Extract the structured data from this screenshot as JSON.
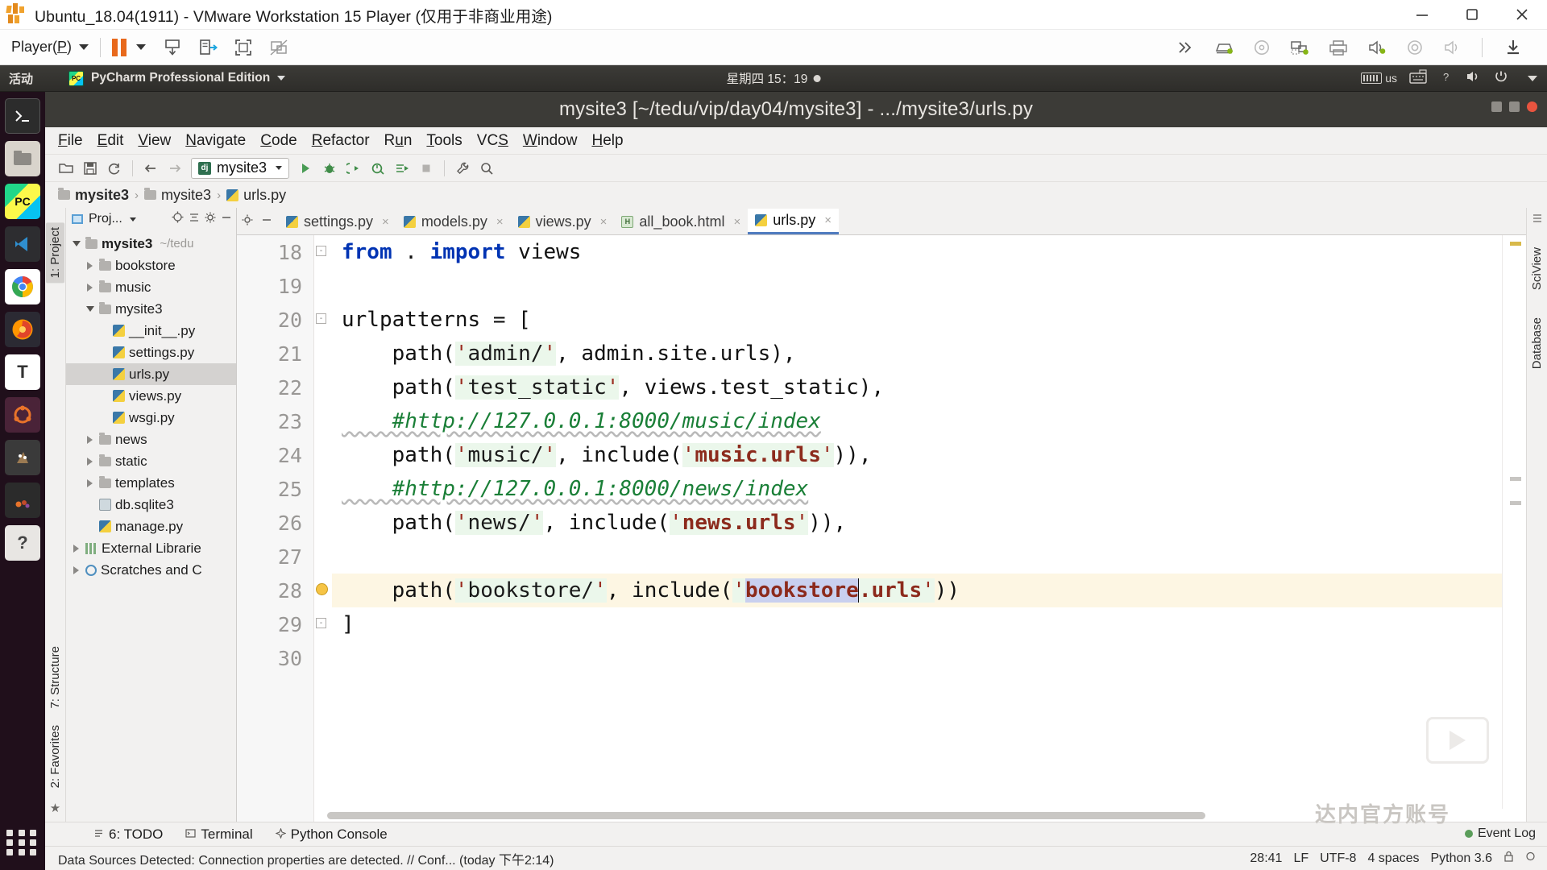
{
  "vmware": {
    "title": "Ubuntu_18.04(1911) - VMware Workstation 15 Player (仅用于非商业用途)",
    "logo_name": "vmware-logo",
    "player_menu": "Player(P)",
    "window_buttons": [
      "minimize",
      "restore",
      "close"
    ],
    "toolbar_icons": [
      "pause-icon",
      "suspend-icon",
      "send-ctrl-alt-del-icon",
      "fullscreen-icon",
      "unity-mode-icon"
    ],
    "right_icons": [
      "expand-icon",
      "removable-hdd-icon",
      "cd-dvd-icon",
      "network-adapter-icon",
      "printer-icon",
      "sound-card-icon",
      "camera-icon",
      "speaker-icon",
      "download-icon"
    ]
  },
  "ubuntu": {
    "activities": "活动",
    "app_name": "PyCharm Professional Edition",
    "clock": "星期四 15：19",
    "tray": [
      "keyboard-layout-us",
      "onscreen-keyboard-icon",
      "help-icon",
      "volume-icon",
      "power-icon"
    ],
    "keyboard_layout": "us",
    "launcher": [
      {
        "name": "terminal",
        "glyph": ">_"
      },
      {
        "name": "files",
        "glyph": ""
      },
      {
        "name": "pycharm",
        "glyph": "PC"
      },
      {
        "name": "vscode",
        "glyph": ""
      },
      {
        "name": "chrome",
        "glyph": ""
      },
      {
        "name": "firefox",
        "glyph": ""
      },
      {
        "name": "text-editor",
        "glyph": "T"
      },
      {
        "name": "ubuntu-software",
        "glyph": ""
      },
      {
        "name": "gimp",
        "glyph": ""
      },
      {
        "name": "software-updater",
        "glyph": ""
      },
      {
        "name": "help",
        "glyph": "?"
      }
    ]
  },
  "pycharm": {
    "window_title": "mysite3 [~/tedu/vip/day04/mysite3] - .../mysite3/urls.py",
    "menu": [
      {
        "label": "File",
        "mnemonic": "F"
      },
      {
        "label": "Edit",
        "mnemonic": "E"
      },
      {
        "label": "View",
        "mnemonic": "V"
      },
      {
        "label": "Navigate",
        "mnemonic": "N"
      },
      {
        "label": "Code",
        "mnemonic": "C"
      },
      {
        "label": "Refactor",
        "mnemonic": "R"
      },
      {
        "label": "Run",
        "mnemonic": "u"
      },
      {
        "label": "Tools",
        "mnemonic": "T"
      },
      {
        "label": "VCS",
        "mnemonic": "S"
      },
      {
        "label": "Window",
        "mnemonic": "W"
      },
      {
        "label": "Help",
        "mnemonic": "H"
      }
    ],
    "toolbar": {
      "icons": [
        "open-icon",
        "save-icon",
        "sync-icon",
        "back-icon",
        "forward-icon"
      ],
      "run_config": "mysite3",
      "run_icons": [
        "run-icon",
        "debug-icon",
        "run-coverage-icon",
        "profile-icon",
        "run-with-console-icon",
        "stop-icon"
      ],
      "end_icons": [
        "settings-wrench-icon",
        "search-icon"
      ]
    },
    "breadcrumb": [
      {
        "label": "mysite3",
        "icon": "folder-icon"
      },
      {
        "label": "mysite3",
        "icon": "folder-icon"
      },
      {
        "label": "urls.py",
        "icon": "python-file-icon"
      }
    ],
    "project_panel": {
      "title": "Proj...",
      "tools": [
        "target-icon",
        "collapse-all-icon",
        "settings-gear-icon",
        "hide-icon"
      ],
      "tree": [
        {
          "label": "mysite3",
          "hint": "~/tedu",
          "icon": "folder-icon",
          "twisty": "down",
          "depth": 0,
          "bold": true
        },
        {
          "label": "bookstore",
          "icon": "folder-icon",
          "twisty": "right",
          "depth": 1
        },
        {
          "label": "music",
          "icon": "folder-icon",
          "twisty": "right",
          "depth": 1
        },
        {
          "label": "mysite3",
          "icon": "folder-icon",
          "twisty": "down",
          "depth": 1
        },
        {
          "label": "__init__.py",
          "icon": "python-file-icon",
          "twisty": "none",
          "depth": 2
        },
        {
          "label": "settings.py",
          "icon": "python-file-icon",
          "twisty": "none",
          "depth": 2
        },
        {
          "label": "urls.py",
          "icon": "python-file-icon",
          "twisty": "none",
          "depth": 2,
          "selected": true
        },
        {
          "label": "views.py",
          "icon": "python-file-icon",
          "twisty": "none",
          "depth": 2
        },
        {
          "label": "wsgi.py",
          "icon": "python-file-icon",
          "twisty": "none",
          "depth": 2
        },
        {
          "label": "news",
          "icon": "folder-icon",
          "twisty": "right",
          "depth": 1
        },
        {
          "label": "static",
          "icon": "folder-icon",
          "twisty": "right",
          "depth": 1
        },
        {
          "label": "templates",
          "icon": "folder-icon",
          "twisty": "right",
          "depth": 1
        },
        {
          "label": "db.sqlite3",
          "icon": "sqlite-file-icon",
          "twisty": "none",
          "depth": 1
        },
        {
          "label": "manage.py",
          "icon": "python-file-icon",
          "twisty": "none",
          "depth": 1
        },
        {
          "label": "External Librarie",
          "icon": "library-icon",
          "twisty": "right",
          "depth": 0
        },
        {
          "label": "Scratches and C",
          "icon": "scratches-icon",
          "twisty": "right",
          "depth": 0
        }
      ]
    },
    "left_rail": [
      "1: Project",
      "7: Structure",
      "2: Favorites"
    ],
    "right_rail": [
      "SciView",
      "Database"
    ],
    "tabs": [
      {
        "label": "settings.py",
        "icon": "python-file-icon",
        "active": false
      },
      {
        "label": "models.py",
        "icon": "python-file-icon",
        "active": false
      },
      {
        "label": "views.py",
        "icon": "python-file-icon",
        "active": false
      },
      {
        "label": "all_book.html",
        "icon": "html-file-icon",
        "active": false
      },
      {
        "label": "urls.py",
        "icon": "python-file-icon",
        "active": true
      }
    ],
    "editor": {
      "first_line": 18,
      "lines": [
        {
          "n": 18,
          "fold": "collapse",
          "tokens": [
            {
              "t": "kw",
              "v": "from"
            },
            {
              "t": "p",
              "v": " . "
            },
            {
              "t": "kw",
              "v": "import"
            },
            {
              "t": "p",
              "v": " views"
            }
          ]
        },
        {
          "n": 19,
          "tokens": []
        },
        {
          "n": 20,
          "fold": "collapse",
          "tokens": [
            {
              "t": "p",
              "v": "urlpatterns = ["
            }
          ]
        },
        {
          "n": 21,
          "tokens": [
            {
              "t": "p",
              "v": "    path("
            },
            {
              "t": "q",
              "v": "'"
            },
            {
              "t": "str",
              "v": "admin/"
            },
            {
              "t": "q",
              "v": "'"
            },
            {
              "t": "p",
              "v": ", admin.site.urls),"
            }
          ]
        },
        {
          "n": 22,
          "tokens": [
            {
              "t": "p",
              "v": "    path("
            },
            {
              "t": "q",
              "v": "'"
            },
            {
              "t": "str",
              "v": "test_static"
            },
            {
              "t": "q",
              "v": "'"
            },
            {
              "t": "p",
              "v": ", views.test_static),"
            }
          ]
        },
        {
          "n": 23,
          "tokens": [
            {
              "t": "cmt",
              "v": "    #http://127.0.0.1:8000/music/index"
            }
          ]
        },
        {
          "n": 24,
          "tokens": [
            {
              "t": "p",
              "v": "    path("
            },
            {
              "t": "q",
              "v": "'"
            },
            {
              "t": "str",
              "v": "music/"
            },
            {
              "t": "q",
              "v": "'"
            },
            {
              "t": "p",
              "v": ", include("
            },
            {
              "t": "q",
              "v": "'"
            },
            {
              "t": "strred",
              "v": "music.urls"
            },
            {
              "t": "q",
              "v": "'"
            },
            {
              "t": "p",
              "v": ")),"
            }
          ]
        },
        {
          "n": 25,
          "tokens": [
            {
              "t": "cmt",
              "v": "    #http://127.0.0.1:8000/news/index"
            }
          ]
        },
        {
          "n": 26,
          "tokens": [
            {
              "t": "p",
              "v": "    path("
            },
            {
              "t": "q",
              "v": "'"
            },
            {
              "t": "str",
              "v": "news/"
            },
            {
              "t": "q",
              "v": "'"
            },
            {
              "t": "p",
              "v": ", include("
            },
            {
              "t": "q",
              "v": "'"
            },
            {
              "t": "strred",
              "v": "news.urls"
            },
            {
              "t": "q",
              "v": "'"
            },
            {
              "t": "p",
              "v": ")),"
            }
          ]
        },
        {
          "n": 27,
          "tokens": []
        },
        {
          "n": 28,
          "highlight": true,
          "bulb": true,
          "tokens": [
            {
              "t": "p",
              "v": "    path("
            },
            {
              "t": "q",
              "v": "'"
            },
            {
              "t": "str",
              "v": "bookstore/"
            },
            {
              "t": "q",
              "v": "'"
            },
            {
              "t": "p",
              "v": ", include("
            },
            {
              "t": "q",
              "v": "'"
            },
            {
              "t": "selred",
              "v": "bookstore"
            },
            {
              "t": "caret",
              "v": ""
            },
            {
              "t": "strred",
              "v": ".urls"
            },
            {
              "t": "q",
              "v": "'"
            },
            {
              "t": "p",
              "v": "))"
            }
          ]
        },
        {
          "n": 29,
          "fold": "collapse",
          "tokens": [
            {
              "t": "p",
              "v": "]"
            }
          ]
        },
        {
          "n": 30,
          "tokens": []
        }
      ]
    },
    "tool_windows": [
      {
        "label": "6: TODO",
        "icon": "todo-icon"
      },
      {
        "label": "Terminal",
        "icon": "terminal-icon"
      },
      {
        "label": "Python Console",
        "icon": "python-console-icon"
      }
    ],
    "status": {
      "message": "Data Sources Detected: Connection properties are detected. // Conf... (today 下午2:14)",
      "caret_pos": "28:41",
      "line_sep": "LF",
      "encoding": "UTF-8",
      "indent": "4 spaces",
      "interpreter": "Python 3.6",
      "event_log": "Event Log"
    },
    "watermark_text": "达内官方账号"
  }
}
